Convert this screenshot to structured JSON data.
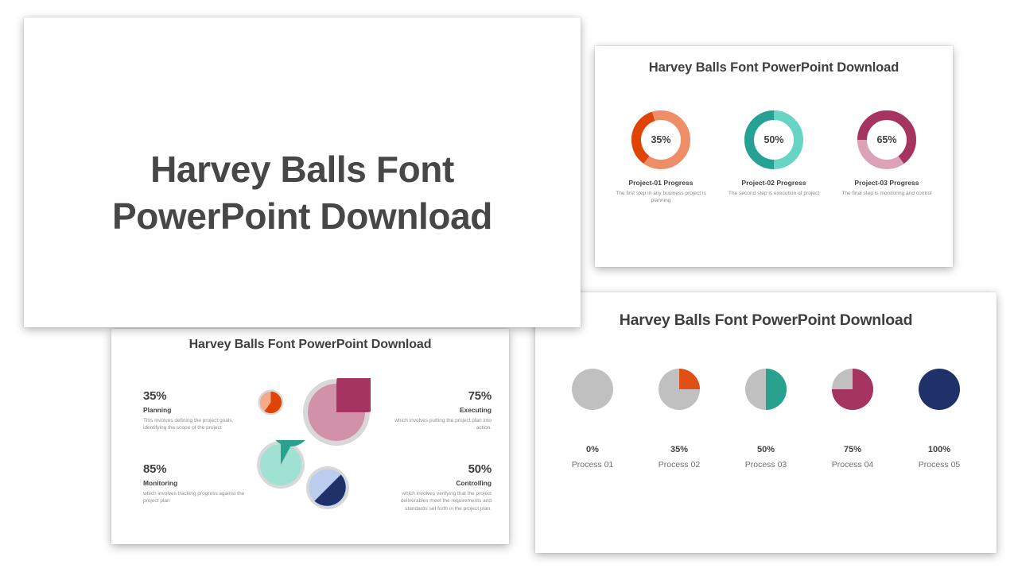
{
  "page": {
    "background": "#ffffff"
  },
  "title_slide": {
    "line1": "Harvey Balls Font",
    "line2": "PowerPoint Download",
    "text_color": "#474747"
  },
  "donut_slide": {
    "heading": "Harvey Balls Font PowerPoint Download",
    "items": [
      {
        "value": "35%",
        "percent": 35,
        "title": "Project-01 Progress",
        "desc": "The first step in any business project is planning",
        "fill_color": "#E04403",
        "track_color": "#EE8E68"
      },
      {
        "value": "50%",
        "percent": 50,
        "title": "Project-02 Progress",
        "desc": "The second step is execution of project",
        "fill_color": "#27A193",
        "track_color": "#68D5C4"
      },
      {
        "value": "65%",
        "percent": 65,
        "title": "Project-03 Progress",
        "desc": "The final step is monitoring and control",
        "fill_color": "#A53560",
        "track_color": "#DCA3B8"
      }
    ]
  },
  "pie_slide": {
    "heading": "Harvey Balls Font PowerPoint Download",
    "items": [
      {
        "id": "planning",
        "pct": "35%",
        "percent": 35,
        "label": "Planning",
        "desc": "This involves defining the project goals, identifying the scope of the project",
        "fill_color": "#E04403",
        "track_color": "#F4A98B",
        "align": "left"
      },
      {
        "id": "executing",
        "pct": "75%",
        "percent": 75,
        "label": "Executing",
        "desc": "which involves putting the project plan into action.",
        "fill_color": "#A53560",
        "track_color": "#D191A8",
        "align": "right"
      },
      {
        "id": "monitoring",
        "pct": "85%",
        "percent": 85,
        "label": "Monitoring",
        "desc": "which involves tracking progress against the project plan",
        "fill_color": "#28A18F",
        "track_color": "#9FE2D3",
        "align": "left"
      },
      {
        "id": "controlling",
        "pct": "50%",
        "percent": 50,
        "label": "Controlling",
        "desc": "which involves verifying that the project deliverables meet the requirements and standards set forth in the project plan.",
        "fill_color": "#1E3269",
        "track_color": "#BACDEE",
        "align": "right"
      }
    ]
  },
  "balls_slide": {
    "heading": "Harvey Balls Font PowerPoint Download",
    "empty_color": "#C0C0C0",
    "items": [
      {
        "pct": "0%",
        "percent": 0,
        "label": "Process 01",
        "fill_color": "#C0C0C0"
      },
      {
        "pct": "35%",
        "percent": 25,
        "label": "Process 02",
        "fill_color": "#E04F16"
      },
      {
        "pct": "50%",
        "percent": 50,
        "label": "Process 03",
        "fill_color": "#28A18F"
      },
      {
        "pct": "75%",
        "percent": 75,
        "label": "Process 04",
        "fill_color": "#A53560"
      },
      {
        "pct": "100%",
        "percent": 100,
        "label": "Process 05",
        "fill_color": "#1E3269"
      }
    ]
  },
  "chart_data": [
    {
      "type": "pie",
      "title": "Project progress donuts",
      "categories": [
        "Project-01 Progress",
        "Project-02 Progress",
        "Project-03 Progress"
      ],
      "values": [
        35,
        50,
        65
      ],
      "unit": "%"
    },
    {
      "type": "pie",
      "title": "Project phase pies",
      "categories": [
        "Planning",
        "Executing",
        "Monitoring",
        "Controlling"
      ],
      "values": [
        35,
        75,
        85,
        50
      ],
      "unit": "%"
    },
    {
      "type": "pie",
      "title": "Harvey balls process completion",
      "categories": [
        "Process 01",
        "Process 02",
        "Process 03",
        "Process 04",
        "Process 05"
      ],
      "values": [
        0,
        35,
        50,
        75,
        100
      ],
      "unit": "%"
    }
  ]
}
